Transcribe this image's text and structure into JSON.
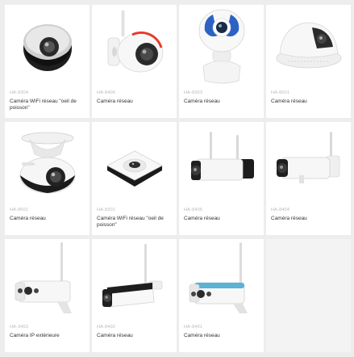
{
  "products": [
    {
      "sku": "HA-8304",
      "title": "Caméra WiFi réseau \"oeil de poisson\"",
      "icon": "fisheye-dome-camera-icon"
    },
    {
      "sku": "HA-8406",
      "title": "Caméra réseau",
      "icon": "wall-mount-camera-icon"
    },
    {
      "sku": "HA-8303",
      "title": "Caméra réseau",
      "icon": "robot-ptz-camera-icon"
    },
    {
      "sku": "HA-8501",
      "title": "Caméra réseau",
      "icon": "ceiling-dome-camera-icon"
    },
    {
      "sku": "HA-8601",
      "title": "Caméra réseau",
      "icon": "ceiling-mount-camera-icon"
    },
    {
      "sku": "HA-8301",
      "title": "Caméra WiFi réseau \"oeil de poisson\"",
      "icon": "square-fisheye-camera-icon"
    },
    {
      "sku": "HA-8405",
      "title": "Caméra réseau",
      "icon": "dual-antenna-bullet-camera-icon"
    },
    {
      "sku": "HA-8404",
      "title": "Caméra réseau",
      "icon": "antenna-bullet-camera-icon"
    },
    {
      "sku": "HA-3403",
      "title": "Caméra IP extérieure",
      "icon": "outdoor-bullet-camera-icon"
    },
    {
      "sku": "HA-8402",
      "title": "Caméra réseau",
      "icon": "black-bullet-camera-icon"
    },
    {
      "sku": "HA-8401",
      "title": "Caméra réseau",
      "icon": "blue-bullet-camera-icon"
    }
  ]
}
